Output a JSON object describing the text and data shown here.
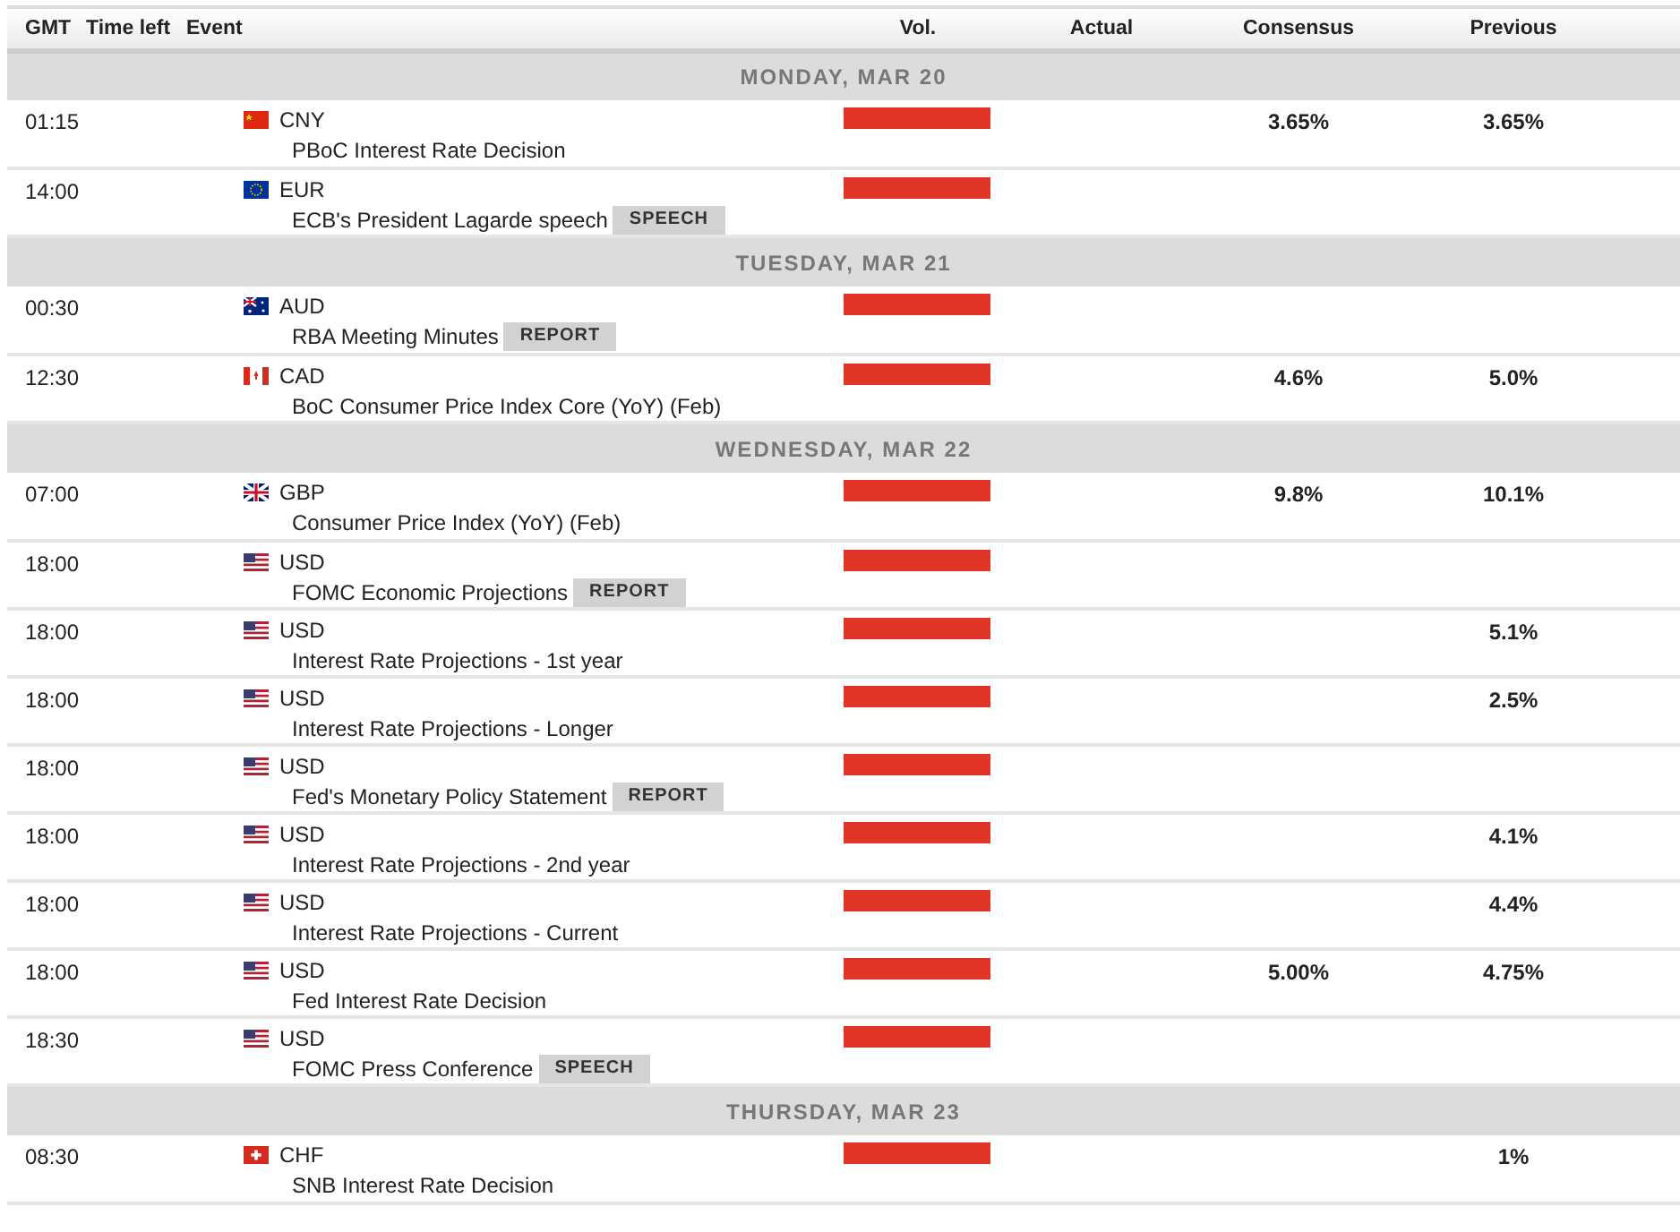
{
  "columns": [
    "GMT",
    "Time left",
    "Event",
    "Vol.",
    "Actual",
    "Consensus",
    "Previous"
  ],
  "days": [
    {
      "label": "MONDAY, MAR 20",
      "events": [
        {
          "time": "01:15",
          "kind": "cn",
          "currency": "CNY",
          "name": "PBoC Interest Rate Decision",
          "level": 1,
          "consensus": "3.65%",
          "previous": "3.65%"
        },
        {
          "time": "14:00",
          "kind": "eu",
          "currency": "EUR",
          "name": "ECB's President Lagarde speech",
          "tag": "SPEECH",
          "level": 1
        }
      ]
    },
    {
      "label": "TUESDAY, MAR 21",
      "events": [
        {
          "time": "00:30",
          "kind": "au",
          "currency": "AUD",
          "name": "RBA Meeting Minutes",
          "tag": "REPORT",
          "level": 1
        },
        {
          "time": "12:30",
          "kind": "ca",
          "currency": "CAD",
          "name": "BoC Consumer Price Index Core (YoY) (Feb)",
          "level": 1,
          "consensus": "4.6%",
          "previous": "5.0%"
        }
      ]
    },
    {
      "label": "WEDNESDAY, MAR 22",
      "events": [
        {
          "time": "07:00",
          "kind": "gb",
          "currency": "GBP",
          "name": "Consumer Price Index (YoY) (Feb)",
          "level": 1,
          "consensus": "9.8%",
          "previous": "10.1%"
        },
        {
          "time": "18:00",
          "kind": "us",
          "currency": "USD",
          "name": "FOMC Economic Projections",
          "tag": "REPORT",
          "level": 1
        },
        {
          "time": "18:00",
          "kind": "us",
          "currency": "USD",
          "name": "Interest Rate Projections - 1st year",
          "level": 1,
          "previous": "5.1%"
        },
        {
          "time": "18:00",
          "kind": "us",
          "currency": "USD",
          "name": "Interest Rate Projections - Longer",
          "level": 1,
          "previous": "2.5%"
        },
        {
          "time": "18:00",
          "kind": "us",
          "currency": "USD",
          "name": "Fed's Monetary Policy Statement",
          "tag": "REPORT",
          "level": 1
        },
        {
          "time": "18:00",
          "kind": "us",
          "currency": "USD",
          "name": "Interest Rate Projections - 2nd year",
          "level": 1,
          "previous": "4.1%"
        },
        {
          "time": "18:00",
          "kind": "us",
          "currency": "USD",
          "name": "Interest Rate Projections - Current",
          "level": 1,
          "previous": "4.4%"
        },
        {
          "time": "18:00",
          "kind": "us",
          "currency": "USD",
          "name": "Fed Interest Rate Decision",
          "level": 1,
          "consensus": "5.00%",
          "previous": "4.75%"
        },
        {
          "time": "18:30",
          "kind": "us",
          "currency": "USD",
          "name": "FOMC Press Conference",
          "tag": "SPEECH",
          "level": 1
        }
      ]
    },
    {
      "label": "THURSDAY, MAR 23",
      "events": [
        {
          "time": "08:30",
          "kind": "ch",
          "currency": "CHF",
          "name": "SNB Interest Rate Decision",
          "level": 1,
          "previous": "1%"
        }
      ]
    }
  ]
}
